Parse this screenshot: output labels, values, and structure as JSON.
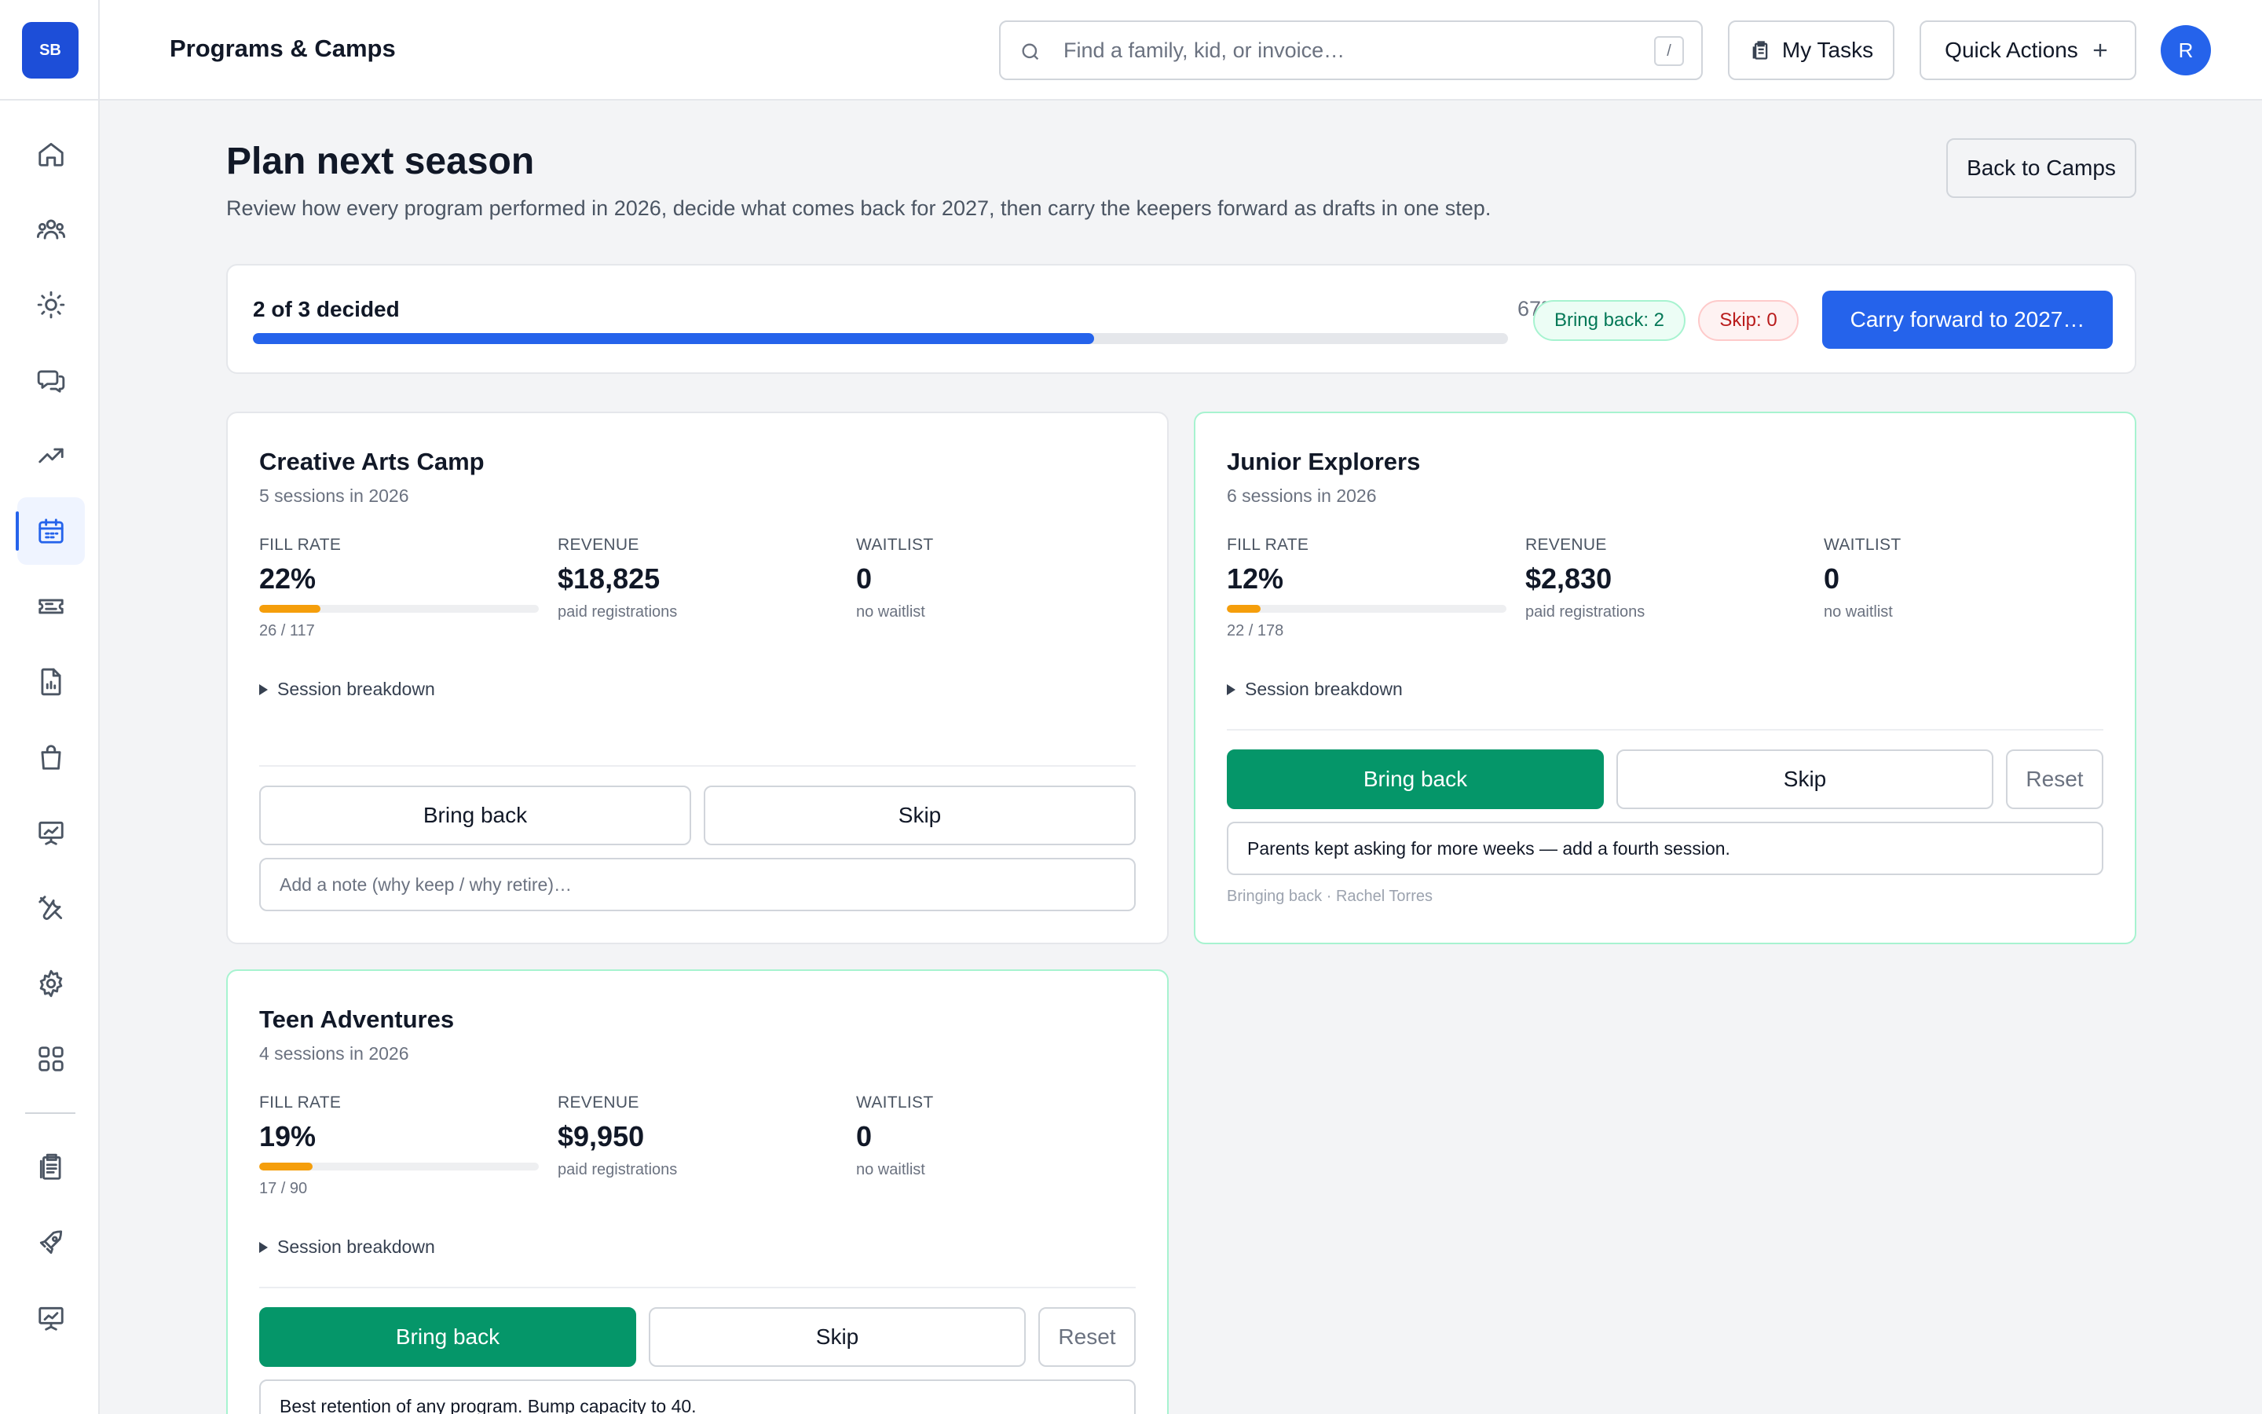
{
  "app": {
    "logo_text": "SB",
    "page_heading": "Programs & Camps"
  },
  "nav": {
    "items": [
      {
        "name": "home-icon",
        "active": false
      },
      {
        "name": "families-icon",
        "active": false
      },
      {
        "name": "sun-icon",
        "active": false
      },
      {
        "name": "messages-icon",
        "active": false
      },
      {
        "name": "trend-icon",
        "active": false
      },
      {
        "name": "calendar-icon",
        "active": true
      },
      {
        "name": "ticket-icon",
        "active": false
      },
      {
        "name": "report-icon",
        "active": false
      },
      {
        "name": "bag-icon",
        "active": false
      },
      {
        "name": "presentation-icon",
        "active": false
      },
      {
        "name": "tools-icon",
        "active": false
      },
      {
        "name": "gear-icon",
        "active": false
      },
      {
        "name": "apps-icon",
        "active": false
      },
      {
        "name": "clipboard-icon",
        "active": false
      },
      {
        "name": "rocket-icon",
        "active": false
      },
      {
        "name": "chart-board-icon",
        "active": false
      }
    ]
  },
  "topbar": {
    "search_placeholder": "Find a family, kid, or invoice…",
    "search_shortcut": "/",
    "my_tasks_label": "My Tasks",
    "quick_actions_label": "Quick Actions",
    "avatar_initial": "R"
  },
  "page": {
    "title": "Plan next season",
    "subtitle": "Review how every program performed in 2026, decide what comes back for 2027, then carry the keepers forward as drafts in one step.",
    "back_label": "Back to Camps"
  },
  "progress": {
    "decided_text": "2 of 3 decided",
    "percent_text": "67%",
    "percent": 67,
    "bring_back_badge": "Bring back: 2",
    "skip_badge": "Skip: 0",
    "carry_forward_label": "Carry forward to 2027…"
  },
  "labels": {
    "fill_rate": "FILL RATE",
    "revenue": "REVENUE",
    "waitlist": "WAITLIST",
    "paid_registrations": "paid registrations",
    "no_waitlist": "no waitlist",
    "session_breakdown": "Session breakdown",
    "bring_back": "Bring back",
    "skip": "Skip",
    "reset": "Reset",
    "note_placeholder": "Add a note (why keep / why retire)…"
  },
  "programs": [
    {
      "title": "Creative Arts Camp",
      "sessions": "5 sessions in 2026",
      "fill_rate": "22%",
      "fill_fraction": 0.22,
      "fill_count": "26 / 117",
      "revenue": "$18,825",
      "waitlist": "0",
      "decision": "none",
      "note": "",
      "status": ""
    },
    {
      "title": "Junior Explorers",
      "sessions": "6 sessions in 2026",
      "fill_rate": "12%",
      "fill_fraction": 0.12,
      "fill_count": "22 / 178",
      "revenue": "$2,830",
      "waitlist": "0",
      "decision": "bring_back",
      "note": "Parents kept asking for more weeks — add a fourth session.",
      "status": "Bringing back · Rachel Torres"
    },
    {
      "title": "Teen Adventures",
      "sessions": "4 sessions in 2026",
      "fill_rate": "19%",
      "fill_fraction": 0.19,
      "fill_count": "17 / 90",
      "revenue": "$9,950",
      "waitlist": "0",
      "decision": "bring_back",
      "note": "Best retention of any program. Bump capacity to 40.",
      "status": ""
    }
  ],
  "colors": {
    "primary": "#2563eb",
    "success": "#059669",
    "fill_bar": "#f59e0b"
  }
}
